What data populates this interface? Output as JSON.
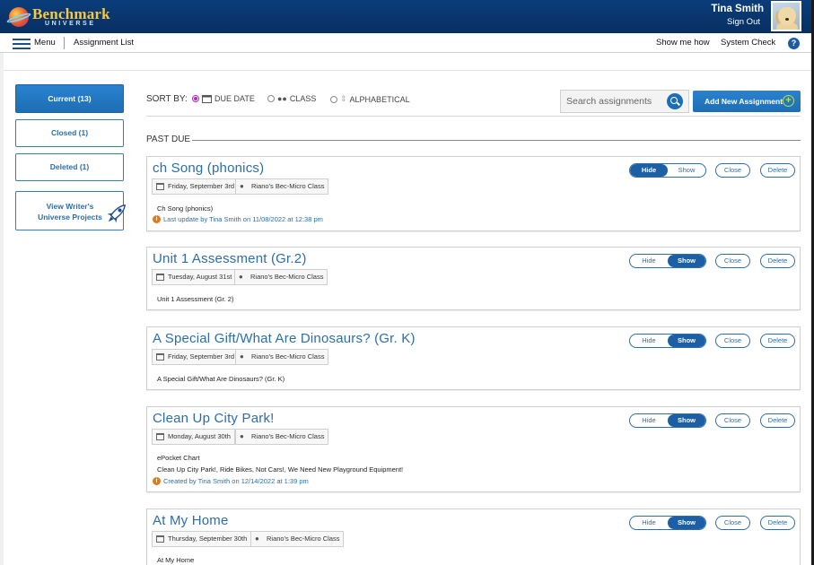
{
  "brand": {
    "name": "Benchmark",
    "sub": "UNIVERSE"
  },
  "user": {
    "name": "Tina Smith",
    "sign_out": "Sign Out"
  },
  "nav": {
    "menu": "Menu",
    "title": "Assignment List",
    "show_me_how": "Show me how",
    "system_check": "System Check",
    "help": "?"
  },
  "sidebar": {
    "current": "Current (13)",
    "closed": "Closed (1)",
    "deleted": "Deleted (1)",
    "projects": "View Writer's Universe Projects"
  },
  "sort": {
    "label": "SORT BY:",
    "options": [
      "DUE DATE",
      "CLASS",
      "ALPHABETICAL"
    ],
    "selected": "DUE DATE"
  },
  "search": {
    "placeholder": "Search assignments"
  },
  "add_button": "Add New Assignment",
  "section": "PAST DUE",
  "toggle": {
    "hide": "Hide",
    "show": "Show"
  },
  "actions": {
    "close": "Close",
    "delete": "Delete"
  },
  "assignments": [
    {
      "title": "ch Song (phonics)",
      "date": "Friday, September 3rd",
      "class": "Riano's Bec-Micro Class",
      "lines": [
        "Ch Song (phonics)"
      ],
      "meta": "Last update by Tina Smith on 11/08/2022 at 12:38 pm",
      "visibility": "Hide"
    },
    {
      "title": "Unit 1 Assessment (Gr.2)",
      "date": "Tuesday, August 31st",
      "class": "Riano's Bec-Micro Class",
      "lines": [
        "Unit 1 Assessment (Gr. 2)"
      ],
      "meta": "",
      "visibility": "Show"
    },
    {
      "title": "A Special Gift/What Are Dinosaurs? (Gr. K)",
      "date": "Friday, September 3rd",
      "class": "Riano's Bec-Micro Class",
      "lines": [
        "A Special Gift/What Are Dinosaurs? (Gr. K)"
      ],
      "meta": "",
      "visibility": "Show"
    },
    {
      "title": "Clean Up City Park!",
      "date": "Monday, August 30th",
      "class": "Riano's Bec-Micro Class",
      "lines": [
        "ePocket Chart",
        "Clean Up City Park!, Ride Bikes, Not Cars!, We Need New Playground Equipment!"
      ],
      "meta": "Created by Tina Smith on 12/14/2022 at 1:39 pm",
      "visibility": "Show"
    },
    {
      "title": "At My Home",
      "date": "Thursday, September 30th",
      "class": "Riano's Bec-Micro Class",
      "lines": [
        "At My Home"
      ],
      "meta": "",
      "visibility": "Show"
    }
  ],
  "colors": {
    "brand_blue": "#0b3d7a",
    "accent_blue": "#1d6eb4",
    "link_blue": "#2c6ea8",
    "logo_gold": "#f5c842",
    "info_orange": "#e07a1a"
  }
}
